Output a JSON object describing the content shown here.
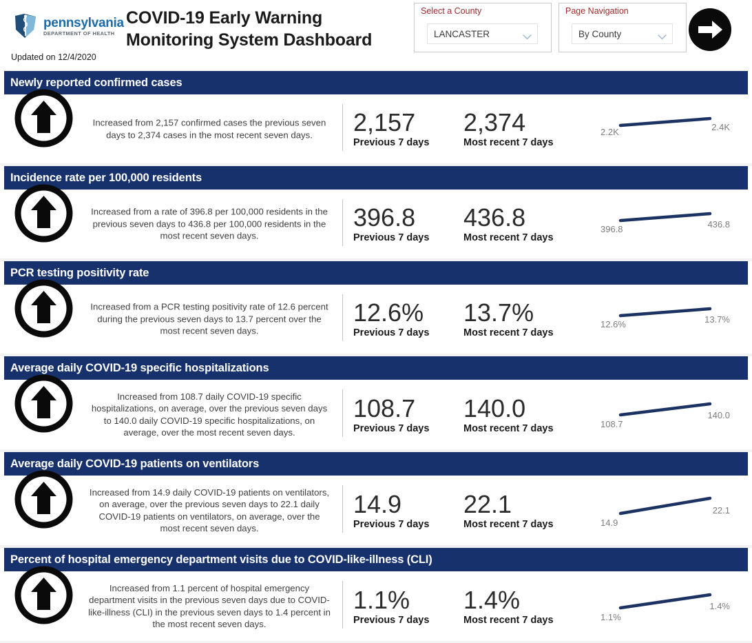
{
  "header": {
    "logo_main": "pennsylvania",
    "logo_sub": "DEPARTMENT OF HEALTH",
    "updated": "Updated on 12/4/2020",
    "title": "COVID-19 Early Warning Monitoring System Dashboard",
    "county_slicer": {
      "label": "Select a County",
      "value": "LANCASTER"
    },
    "page_nav_slicer": {
      "label": "Page Navigation",
      "value": "By County"
    },
    "next_page_button": "next-page"
  },
  "metrics": [
    {
      "title": "Newly reported confirmed cases",
      "trend_icon": "arrow-up-circle-icon",
      "description": "Increased from 2,157 confirmed cases the previous seven days to 2,374 cases in the most recent seven days.",
      "previous_value": "2,157",
      "previous_label": "Previous 7 days",
      "recent_value": "2,374",
      "recent_label": "Most recent 7 days",
      "spark_start_label": "2.2K",
      "spark_end_label": "2.4K"
    },
    {
      "title": "Incidence rate per 100,000 residents",
      "trend_icon": "arrow-up-circle-icon",
      "description": "Increased from a rate of 396.8 per 100,000 residents in the previous seven days to 436.8 per 100,000 residents in the most recent seven days.",
      "previous_value": "396.8",
      "previous_label": "Previous 7 days",
      "recent_value": "436.8",
      "recent_label": "Most recent 7 days",
      "spark_start_label": "396.8",
      "spark_end_label": "436.8"
    },
    {
      "title": "PCR testing positivity rate",
      "trend_icon": "arrow-up-circle-icon",
      "description": "Increased from a PCR testing positivity rate of 12.6 percent during the previous seven days to 13.7 percent over the most recent seven days.",
      "previous_value": "12.6%",
      "previous_label": "Previous 7 days",
      "recent_value": "13.7%",
      "recent_label": "Most recent 7 days",
      "spark_start_label": "12.6%",
      "spark_end_label": "13.7%"
    },
    {
      "title": "Average daily COVID-19 specific hospitalizations",
      "trend_icon": "arrow-up-circle-icon",
      "description": "Increased from 108.7 daily COVID-19 specific hospitalizations, on average, over the previous seven days to 140.0 daily COVID-19 specific hospitalizations, on average, over the most recent seven days.",
      "previous_value": "108.7",
      "previous_label": "Previous 7 days",
      "recent_value": "140.0",
      "recent_label": "Most recent 7 days",
      "spark_start_label": "108.7",
      "spark_end_label": "140.0"
    },
    {
      "title": "Average daily COVID-19 patients on ventilators",
      "trend_icon": "arrow-up-circle-icon",
      "description": "Increased from 14.9 daily COVID-19 patients on ventilators, on average, over the previous seven days to 22.1 daily COVID-19 patients on ventilators, on average, over the most recent seven days.",
      "previous_value": "14.9",
      "previous_label": "Previous 7 days",
      "recent_value": "22.1",
      "recent_label": "Most recent 7 days",
      "spark_start_label": "14.9",
      "spark_end_label": "22.1"
    },
    {
      "title": "Percent of hospital emergency department visits due to COVID-like-illness (CLI)",
      "trend_icon": "arrow-up-circle-icon",
      "description": "Increased from 1.1 percent of hospital emergency department visits in the previous seven days due to COVID-like-illness (CLI) in the previous seven days to 1.4 percent in the most recent seven days.",
      "previous_value": "1.1%",
      "previous_label": "Previous 7 days",
      "recent_value": "1.4%",
      "recent_label": "Most recent 7 days",
      "spark_start_label": "1.1%",
      "spark_end_label": "1.4%"
    }
  ],
  "chart_data": [
    {
      "type": "line",
      "title": "Newly reported confirmed cases",
      "x": [
        "Previous 7 days",
        "Most recent 7 days"
      ],
      "values": [
        2157,
        2374
      ],
      "point_labels": [
        "2.2K",
        "2.4K"
      ],
      "ylabel": "",
      "xlabel": "",
      "grid": false,
      "legend": "none"
    },
    {
      "type": "line",
      "title": "Incidence rate per 100,000 residents",
      "x": [
        "Previous 7 days",
        "Most recent 7 days"
      ],
      "values": [
        396.8,
        436.8
      ],
      "point_labels": [
        "396.8",
        "436.8"
      ],
      "ylabel": "",
      "xlabel": "",
      "grid": false,
      "legend": "none"
    },
    {
      "type": "line",
      "title": "PCR testing positivity rate",
      "x": [
        "Previous 7 days",
        "Most recent 7 days"
      ],
      "values": [
        12.6,
        13.7
      ],
      "point_labels": [
        "12.6%",
        "13.7%"
      ],
      "ylabel": "",
      "xlabel": "",
      "grid": false,
      "legend": "none"
    },
    {
      "type": "line",
      "title": "Average daily COVID-19 specific hospitalizations",
      "x": [
        "Previous 7 days",
        "Most recent 7 days"
      ],
      "values": [
        108.7,
        140.0
      ],
      "point_labels": [
        "108.7",
        "140.0"
      ],
      "ylabel": "",
      "xlabel": "",
      "grid": false,
      "legend": "none"
    },
    {
      "type": "line",
      "title": "Average daily COVID-19 patients on ventilators",
      "x": [
        "Previous 7 days",
        "Most recent 7 days"
      ],
      "values": [
        14.9,
        22.1
      ],
      "point_labels": [
        "14.9",
        "22.1"
      ],
      "ylabel": "",
      "xlabel": "",
      "grid": false,
      "legend": "none"
    },
    {
      "type": "line",
      "title": "Percent of hospital emergency department visits due to COVID-like-illness (CLI)",
      "x": [
        "Previous 7 days",
        "Most recent 7 days"
      ],
      "values": [
        1.1,
        1.4
      ],
      "point_labels": [
        "1.1%",
        "1.4%"
      ],
      "ylabel": "",
      "xlabel": "",
      "grid": false,
      "legend": "none"
    }
  ],
  "colors": {
    "bar_navy": "#16316b",
    "spark_line": "#1b3263",
    "slicer_label_red": "#9c2b2b",
    "logo_blue": "#1b6ca8"
  }
}
